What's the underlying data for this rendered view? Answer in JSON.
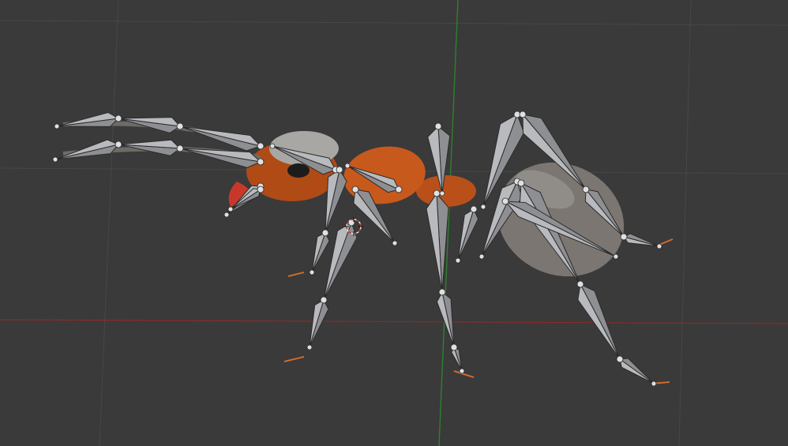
{
  "viewport": {
    "background_color": "#3a3a3a",
    "grid_color": "#474747",
    "x_axis_color": "#8b2a2a",
    "y_axis_color": "#2f7f2f"
  },
  "scene": {
    "object": "ant-model-with-armature",
    "colors": {
      "thorax_orange": "#c8591c",
      "head_orange": "#b04b16",
      "head_cap_gray": "#a9a7a3",
      "abdomen_gray": "#7b7672",
      "bone_fill": "#b9babd",
      "bone_outline": "#2b2b2b",
      "mandible_red": "#c8382a",
      "leg_tip_orange": "#d06a2a",
      "eye_black": "#1c1c1c"
    },
    "selection_cursor": {
      "icon": "3d-cursor-icon"
    }
  }
}
